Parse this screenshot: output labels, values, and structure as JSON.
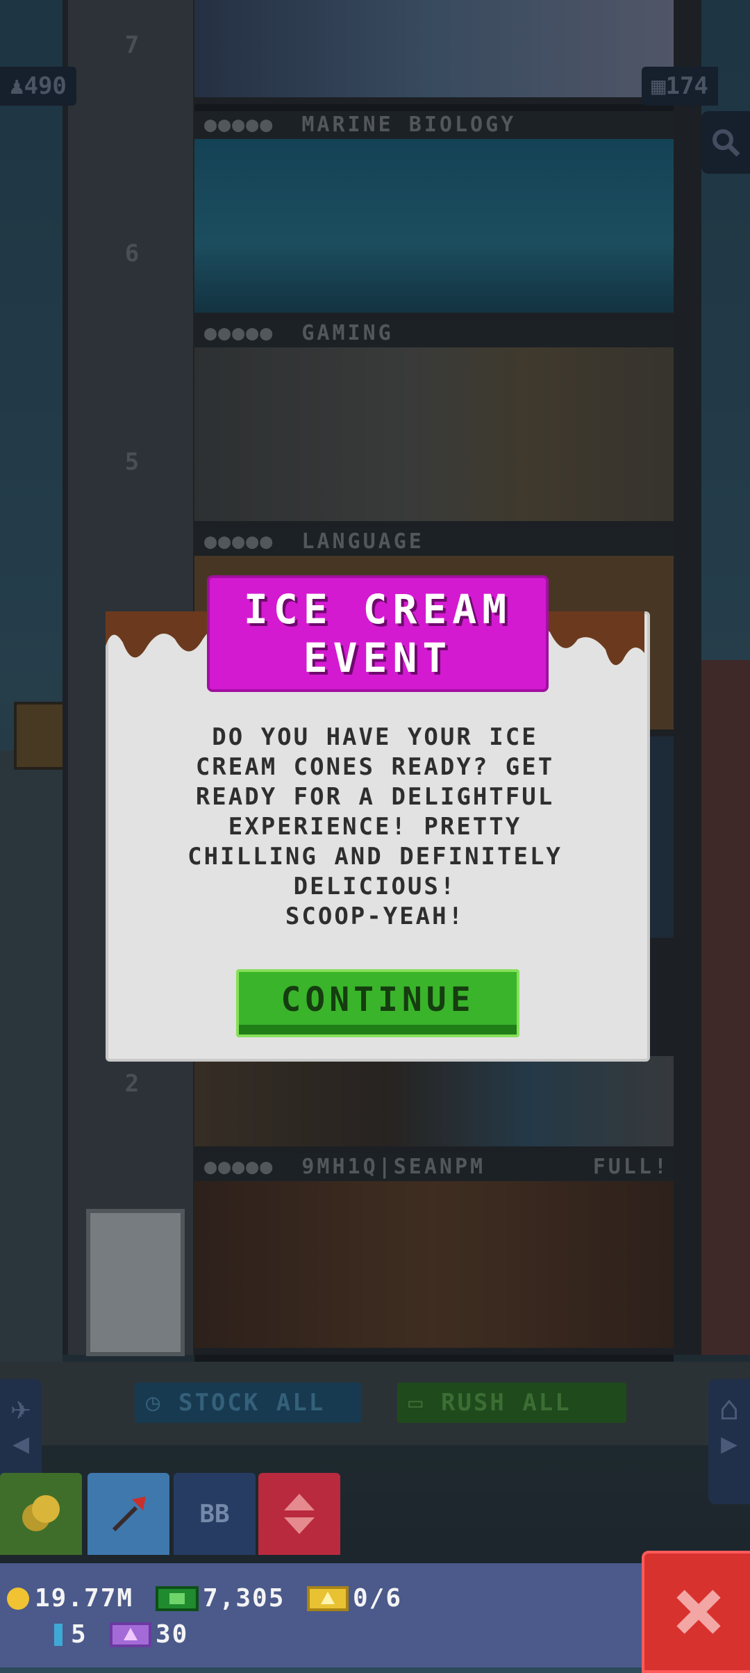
{
  "hud": {
    "population": "490",
    "floors": "174"
  },
  "floors": [
    {
      "number": "7",
      "name": ""
    },
    {
      "number": "6",
      "name": "MARINE BIOLOGY"
    },
    {
      "number": "5",
      "name": "GAMING"
    },
    {
      "number": "",
      "name": "LANGUAGE"
    },
    {
      "number": "2",
      "name": ""
    },
    {
      "number": "",
      "name": "9MH1Q|SEANPM",
      "status": "FULL!"
    }
  ],
  "popup": {
    "title": "ICE CREAM\nEVENT",
    "message": "DO YOU HAVE YOUR ICE\nCREAM CONES READY? GET\nREADY FOR A DELIGHTFUL\nEXPERIENCE! PRETTY\nCHILLING AND DEFINITELY\nDELICIOUS!\nSCOOP-YEAH!",
    "continue_label": "CONTINUE"
  },
  "actions": {
    "stock_all": "STOCK ALL",
    "rush_all": "RUSH ALL"
  },
  "tools": {
    "bb_label": "BB"
  },
  "stats": {
    "coins": "19.77M",
    "bux": "7,305",
    "tickets": "0/6",
    "keys": "5",
    "vip": "30"
  },
  "colors": {
    "popup_title": "#d31ad1",
    "continue_button": "#3ab42a",
    "close_button": "#d8322f",
    "bottom_bar": "#4b5a8a"
  }
}
